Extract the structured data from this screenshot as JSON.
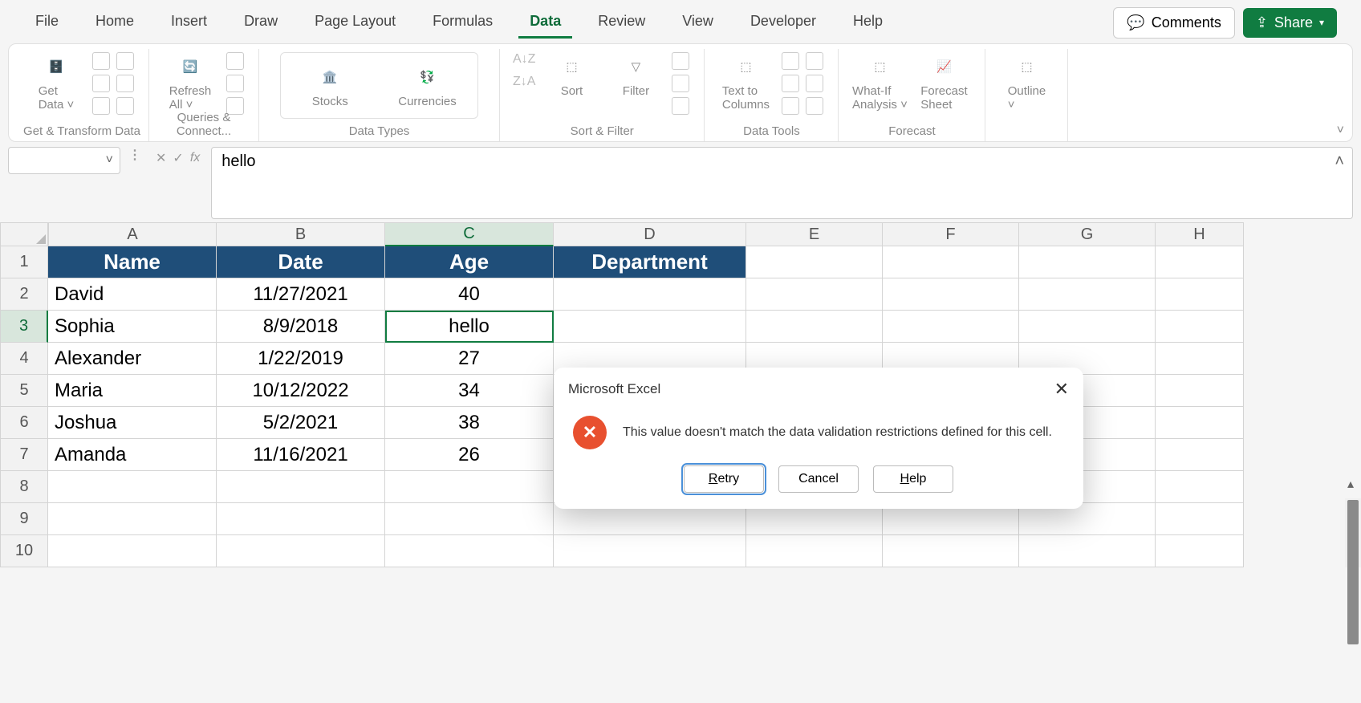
{
  "tabs": [
    "File",
    "Home",
    "Insert",
    "Draw",
    "Page Layout",
    "Formulas",
    "Data",
    "Review",
    "View",
    "Developer",
    "Help"
  ],
  "active_tab": "Data",
  "buttons": {
    "comments": "Comments",
    "share": "Share"
  },
  "ribbon_groups": {
    "get_transform": {
      "get_data": "Get\nData ˅",
      "label": "Get & Transform Data"
    },
    "queries": {
      "refresh": "Refresh\nAll ˅",
      "label": "Queries & Connect..."
    },
    "data_types": {
      "stocks": "Stocks",
      "currencies": "Currencies",
      "label": "Data Types"
    },
    "sort_filter": {
      "sort": "Sort",
      "filter": "Filter",
      "label": "Sort & Filter"
    },
    "data_tools": {
      "text_to_cols": "Text to\nColumns",
      "label": "Data Tools"
    },
    "forecast": {
      "whatif": "What-If\nAnalysis ˅",
      "forecast_sheet": "Forecast\nSheet",
      "label": "Forecast"
    },
    "outline": {
      "outline": "Outline\n˅"
    }
  },
  "formula_bar": {
    "fx": "fx",
    "value": "hello"
  },
  "columns": [
    "A",
    "B",
    "C",
    "D",
    "E",
    "F",
    "G",
    "H"
  ],
  "header_row": [
    "Name",
    "Date",
    "Age",
    "Department"
  ],
  "data_rows": [
    {
      "name": "David",
      "date": "11/27/2021",
      "age": "40"
    },
    {
      "name": "Sophia",
      "date": "8/9/2018",
      "age": "hello"
    },
    {
      "name": "Alexander",
      "date": "1/22/2019",
      "age": "27"
    },
    {
      "name": "Maria",
      "date": "10/12/2022",
      "age": "34"
    },
    {
      "name": "Joshua",
      "date": "5/2/2021",
      "age": "38"
    },
    {
      "name": "Amanda",
      "date": "11/16/2021",
      "age": "26"
    }
  ],
  "row_numbers": [
    "1",
    "2",
    "3",
    "4",
    "5",
    "6",
    "7",
    "8",
    "9",
    "10"
  ],
  "active_cell": "C3",
  "dialog": {
    "title": "Microsoft Excel",
    "message": "This value doesn't match the data validation restrictions defined for this cell.",
    "retry": "Retry",
    "cancel": "Cancel",
    "help": "Help"
  }
}
